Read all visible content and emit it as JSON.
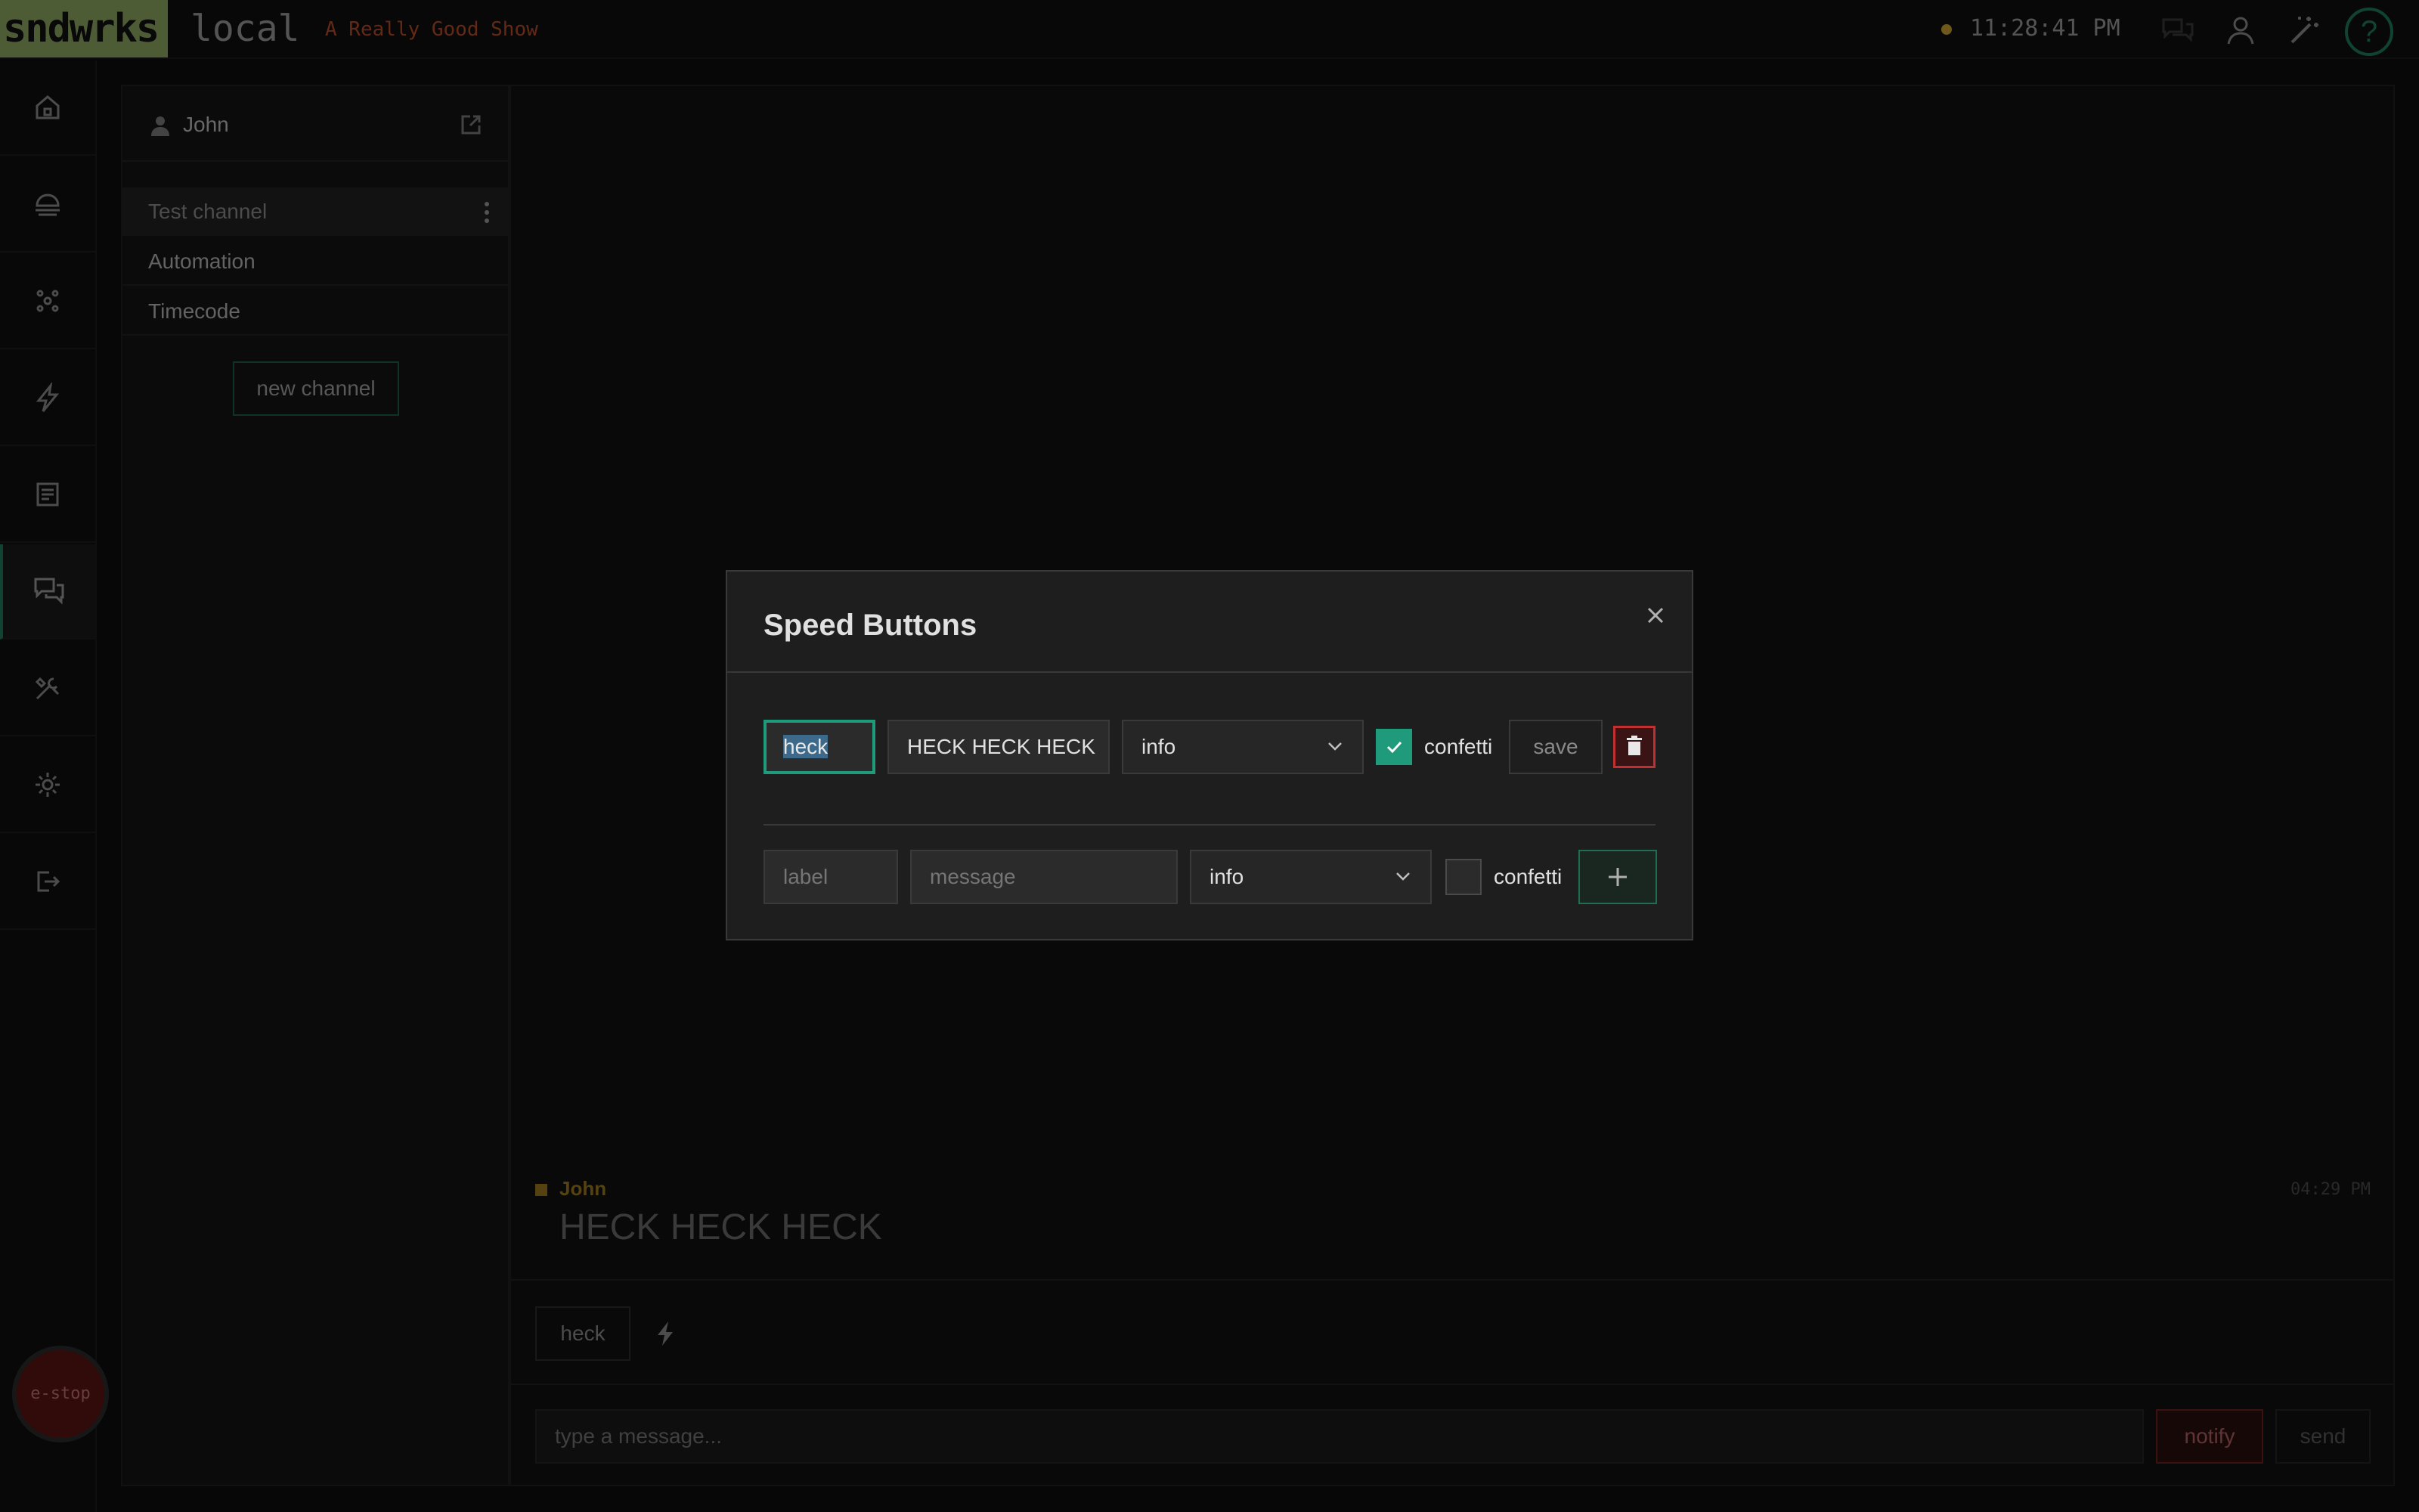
{
  "topbar": {
    "brand": "sndwrks",
    "environment": "local",
    "show_name": "A Really Good Show",
    "clock": "11:28:41 PM",
    "status_color": "#c8a030",
    "icons": [
      "chat-icon",
      "user-icon",
      "magic-wand-icon"
    ],
    "help_label": "?"
  },
  "leftnav": {
    "items": [
      {
        "icon": "home-icon",
        "active": false
      },
      {
        "icon": "cues-icon",
        "active": false
      },
      {
        "icon": "network-icon",
        "active": false
      },
      {
        "icon": "lightning-icon",
        "active": false
      },
      {
        "icon": "document-icon",
        "active": false
      },
      {
        "icon": "chat-icon",
        "active": true
      },
      {
        "icon": "tools-icon",
        "active": false
      },
      {
        "icon": "gear-icon",
        "active": false
      },
      {
        "icon": "logout-icon",
        "active": false
      }
    ],
    "estop_label": "e-stop"
  },
  "channels": {
    "user_name": "John",
    "items": [
      {
        "label": "Test channel",
        "selected": true
      },
      {
        "label": "Automation",
        "selected": false
      },
      {
        "label": "Timecode",
        "selected": false
      }
    ],
    "new_channel_label": "new channel"
  },
  "messages": [
    {
      "author": "John",
      "text": "HECK HECK HECK",
      "time": "04:29 PM"
    }
  ],
  "speed_bar": {
    "chips": [
      "heck"
    ]
  },
  "composer": {
    "placeholder": "type a message...",
    "notify_label": "notify",
    "send_label": "send"
  },
  "modal": {
    "title": "Speed Buttons",
    "existing_row": {
      "label_value": "heck",
      "message_value": "HECK HECK HECK",
      "type_value": "info",
      "confetti_checked": true,
      "confetti_label": "confetti",
      "save_label": "save"
    },
    "new_row": {
      "label_placeholder": "label",
      "message_placeholder": "message",
      "type_value": "info",
      "confetti_checked": false,
      "confetti_label": "confetti"
    }
  },
  "colors": {
    "accent": "#1f9a7a",
    "brand": "#8fa862",
    "danger": "#c03030",
    "author": "#9a7a20"
  }
}
